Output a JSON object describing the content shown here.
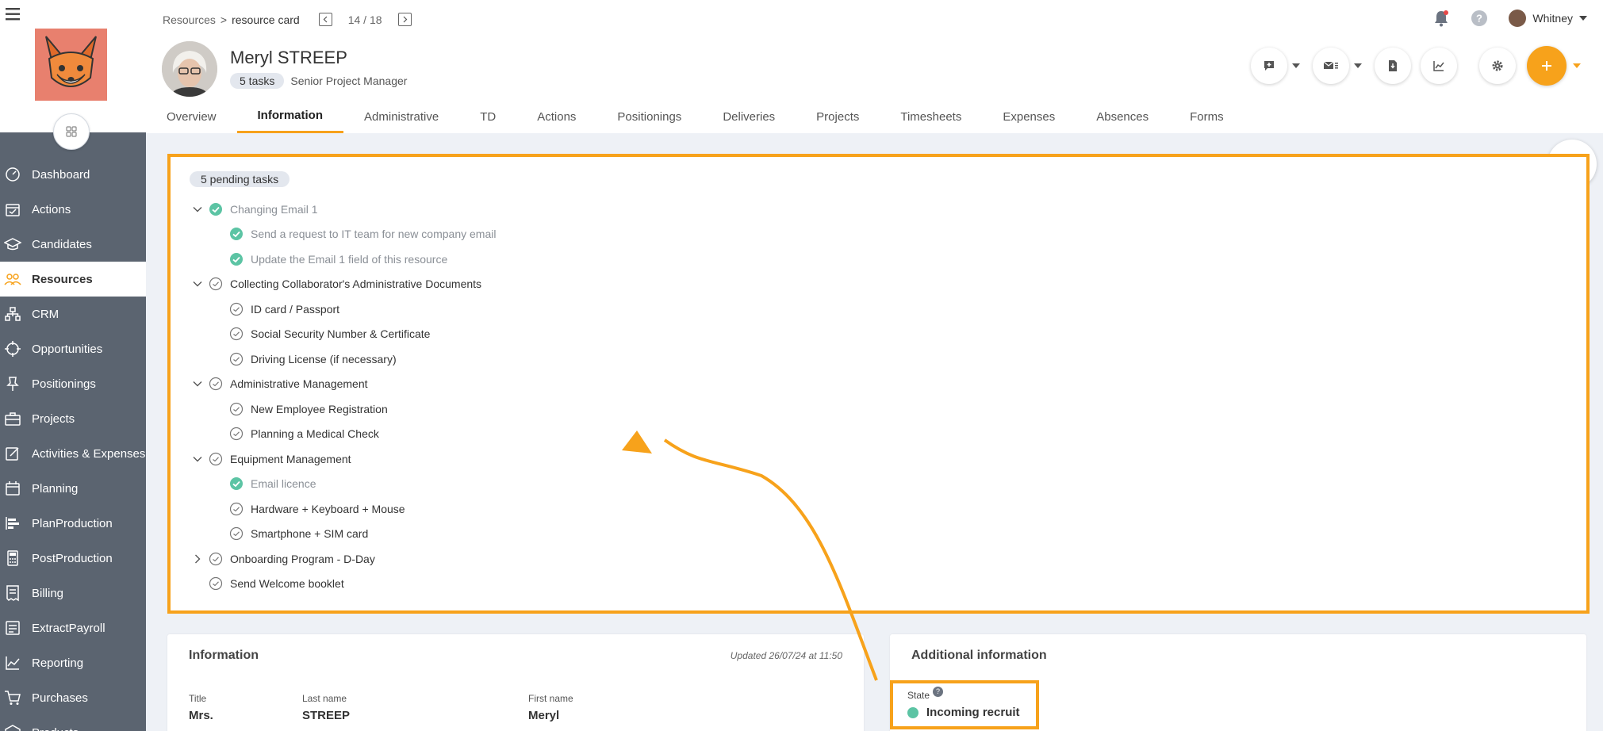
{
  "breadcrumb": {
    "parent": "Resources",
    "separator": ">",
    "current": "resource card",
    "pager": "14 / 18"
  },
  "user": {
    "name": "Whitney"
  },
  "profile": {
    "name": "Meryl STREEP",
    "tasks_badge": "5 tasks",
    "role": "Senior Project Manager"
  },
  "sidebar": {
    "items": [
      {
        "label": "Dashboard",
        "icon": "dashboard-icon"
      },
      {
        "label": "Actions",
        "icon": "calendar-check-icon"
      },
      {
        "label": "Candidates",
        "icon": "graduation-cap-icon"
      },
      {
        "label": "Resources",
        "icon": "people-icon",
        "active": true
      },
      {
        "label": "CRM",
        "icon": "org-chart-icon"
      },
      {
        "label": "Opportunities",
        "icon": "crosshair-icon"
      },
      {
        "label": "Positionings",
        "icon": "pin-icon"
      },
      {
        "label": "Projects",
        "icon": "briefcase-icon"
      },
      {
        "label": "Activities & Expenses",
        "icon": "edit-icon"
      },
      {
        "label": "Planning",
        "icon": "calendar-icon"
      },
      {
        "label": "PlanProduction",
        "icon": "bars-icon"
      },
      {
        "label": "PostProduction",
        "icon": "calculator-icon"
      },
      {
        "label": "Billing",
        "icon": "invoice-icon"
      },
      {
        "label": "ExtractPayroll",
        "icon": "payroll-icon"
      },
      {
        "label": "Reporting",
        "icon": "chart-line-icon"
      },
      {
        "label": "Purchases",
        "icon": "cart-icon"
      },
      {
        "label": "Products",
        "icon": "box-icon"
      }
    ]
  },
  "tabs": [
    "Overview",
    "Information",
    "Administrative",
    "TD",
    "Actions",
    "Positionings",
    "Deliveries",
    "Projects",
    "Timesheets",
    "Expenses",
    "Absences",
    "Forms"
  ],
  "tasks": {
    "pending_badge": "5 pending tasks",
    "items": [
      {
        "label": "Changing Email 1",
        "level": 0,
        "chevron": "down",
        "done": true
      },
      {
        "label": "Send a request to IT team for new company email",
        "level": 1,
        "done": true
      },
      {
        "label": "Update the Email 1 field of this resource",
        "level": 1,
        "done": true
      },
      {
        "label": "Collecting Collaborator's Administrative Documents",
        "level": 0,
        "chevron": "down",
        "done": false
      },
      {
        "label": "ID card / Passport",
        "level": 1,
        "done": false
      },
      {
        "label": "Social Security Number & Certificate",
        "level": 1,
        "done": false
      },
      {
        "label": "Driving License (if necessary)",
        "level": 1,
        "done": false
      },
      {
        "label": "Administrative Management",
        "level": 0,
        "chevron": "down",
        "done": false
      },
      {
        "label": "New Employee Registration",
        "level": 1,
        "done": false
      },
      {
        "label": "Planning a Medical Check",
        "level": 1,
        "done": false
      },
      {
        "label": "Equipment Management",
        "level": 0,
        "chevron": "down",
        "done": false
      },
      {
        "label": "Email licence",
        "level": 1,
        "done": true
      },
      {
        "label": "Hardware + Keyboard + Mouse",
        "level": 1,
        "done": false
      },
      {
        "label": "Smartphone + SIM card",
        "level": 1,
        "done": false
      },
      {
        "label": "Onboarding Program - D-Day",
        "level": 0,
        "chevron": "right",
        "done": false
      },
      {
        "label": "Send Welcome booklet",
        "level": 0,
        "chevron": "none",
        "done": false
      }
    ]
  },
  "info_card": {
    "title": "Information",
    "updated": "Updated 26/07/24 at 11:50",
    "fields": [
      {
        "label": "Title",
        "value": "Mrs."
      },
      {
        "label": "Last name",
        "value": "STREEP"
      },
      {
        "label": "First name",
        "value": "Meryl"
      }
    ]
  },
  "additional_card": {
    "title": "Additional information",
    "state_label": "State",
    "state_help": "?",
    "state_value": "Incoming recruit"
  },
  "colors": {
    "accent": "#f7a21b",
    "done": "#5cc4a4",
    "sidebar": "#5b6470"
  }
}
